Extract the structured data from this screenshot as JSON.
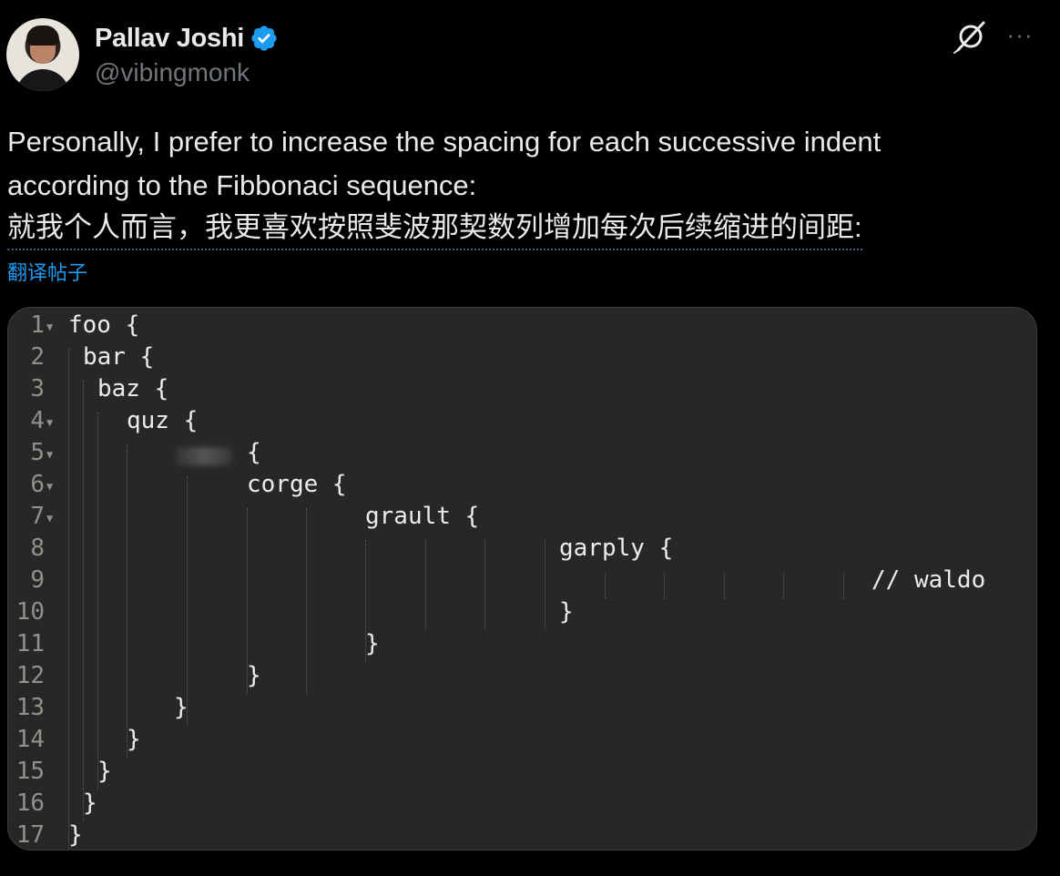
{
  "author": {
    "name": "Pallav Joshi",
    "handle": "@vibingmonk",
    "verified": true,
    "verified_color": "#1d9bf0"
  },
  "actions": {
    "grok_icon": "grok-icon",
    "more_label": "···"
  },
  "tweet": {
    "text_lines": [
      "Personally, I prefer to increase the spacing for each successive indent",
      "according to the Fibbonaci sequence:"
    ],
    "translated_text": "就我个人而言，我更喜欢按照斐波那契数列增加每次后续缩进的间距:",
    "translate_link": "翻译帖子"
  },
  "code_image": {
    "lines": [
      {
        "n": "1",
        "text": "foo {",
        "fold": true
      },
      {
        "n": "2",
        "text": "bar {",
        "fold": false
      },
      {
        "n": "3",
        "text": "baz {",
        "fold": false
      },
      {
        "n": "4",
        "text": "quz {",
        "fold": true
      },
      {
        "n": "5",
        "text": "{",
        "fold": true
      },
      {
        "n": "6",
        "text": "corge {",
        "fold": true
      },
      {
        "n": "7",
        "text": "grault {",
        "fold": true
      },
      {
        "n": "8",
        "text": "garply {",
        "fold": false
      },
      {
        "n": "9",
        "text": "// waldo",
        "fold": false
      },
      {
        "n": "10",
        "text": "}",
        "fold": false
      },
      {
        "n": "11",
        "text": "}",
        "fold": false
      },
      {
        "n": "12",
        "text": "}",
        "fold": false
      },
      {
        "n": "13",
        "text": "}",
        "fold": false
      },
      {
        "n": "14",
        "text": "}",
        "fold": false
      },
      {
        "n": "15",
        "text": "}",
        "fold": false
      },
      {
        "n": "16",
        "text": "}",
        "fold": false
      },
      {
        "n": "17",
        "text": "}",
        "fold": false
      }
    ]
  }
}
